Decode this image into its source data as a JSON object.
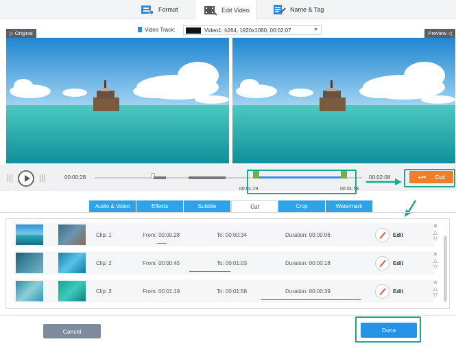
{
  "top_tabs": {
    "format": "Format",
    "edit_video": "Edit Video",
    "name_tag": "Name & Tag"
  },
  "video_track": {
    "label": "Video Track:",
    "selected": "Video1: h264, 1920x1080, 00:02:07"
  },
  "panes": {
    "original": "Original",
    "preview": "Preview"
  },
  "playback": {
    "current_time": "00:00:28",
    "end_time": "00:02:08",
    "sel_start": "00:01:19",
    "sel_end": "00:01:58",
    "cut_label": "Cut"
  },
  "edit_tabs": [
    "Audio & Video",
    "Effects",
    "Subtitle",
    "Cut",
    "Crop",
    "Watermark"
  ],
  "clips": [
    {
      "clip": "Clip: 1",
      "from": "From:   00:00:28",
      "to": "To:   00:00:34",
      "duration": "Duration: 00:00:06",
      "edit": "Edit"
    },
    {
      "clip": "Clip: 2",
      "from": "From:   00:00:45",
      "to": "To:   00:01:03",
      "duration": "Duration: 00:00:18",
      "edit": "Edit"
    },
    {
      "clip": "Clip: 3",
      "from": "From:   00:01:19",
      "to": "To:   00:01:58",
      "duration": "Duration: 00:00:39",
      "edit": "Edit"
    }
  ],
  "buttons": {
    "cancel": "Cancel",
    "done": "Done"
  },
  "colors": {
    "accent": "#2ea3e8",
    "cut": "#f07e2a",
    "highlight": "#1aa889",
    "done": "#2693e6",
    "cancel": "#7d8b9c"
  }
}
